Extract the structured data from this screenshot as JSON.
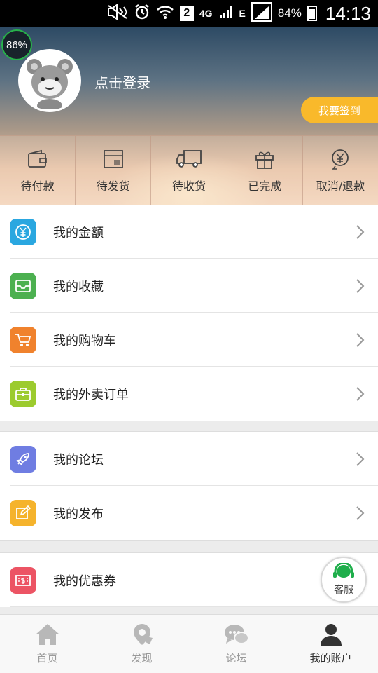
{
  "status_bar": {
    "sim_label": "2",
    "network": "4G",
    "edge": "E",
    "battery": "84%",
    "time": "14:13",
    "icons": [
      "mute-icon",
      "alarm-icon",
      "wifi-icon",
      "signal-icon",
      "battery-icon"
    ]
  },
  "header": {
    "memory_badge": "86%",
    "login_text": "点击登录",
    "checkin_label": "我要签到"
  },
  "orders": [
    {
      "label": "待付款",
      "icon": "wallet-icon"
    },
    {
      "label": "待发货",
      "icon": "package-icon"
    },
    {
      "label": "待收货",
      "icon": "truck-icon"
    },
    {
      "label": "已完成",
      "icon": "gift-icon"
    },
    {
      "label": "取消/退款",
      "icon": "refund-icon"
    }
  ],
  "menu_group_1": [
    {
      "label": "我的金额",
      "icon": "yen-icon",
      "color": "#2aa7e0"
    },
    {
      "label": "我的收藏",
      "icon": "inbox-icon",
      "color": "#4cb050"
    },
    {
      "label": "我的购物车",
      "icon": "cart-icon",
      "color": "#f0822d"
    },
    {
      "label": "我的外卖订单",
      "icon": "briefcase-icon",
      "color": "#9ccb2e"
    }
  ],
  "menu_group_2": [
    {
      "label": "我的论坛",
      "icon": "rocket-icon",
      "color": "#6f7de2"
    },
    {
      "label": "我的发布",
      "icon": "edit-icon",
      "color": "#f5b32c"
    }
  ],
  "menu_group_3": [
    {
      "label": "我的优惠券",
      "icon": "coupon-icon",
      "color": "#ec5464"
    }
  ],
  "customer_service": {
    "label": "客服"
  },
  "bottom_nav": [
    {
      "label": "首页",
      "icon": "home-icon",
      "active": false
    },
    {
      "label": "发现",
      "icon": "location-icon",
      "active": false
    },
    {
      "label": "论坛",
      "icon": "chat-icon",
      "active": false
    },
    {
      "label": "我的账户",
      "icon": "user-icon",
      "active": true
    }
  ]
}
